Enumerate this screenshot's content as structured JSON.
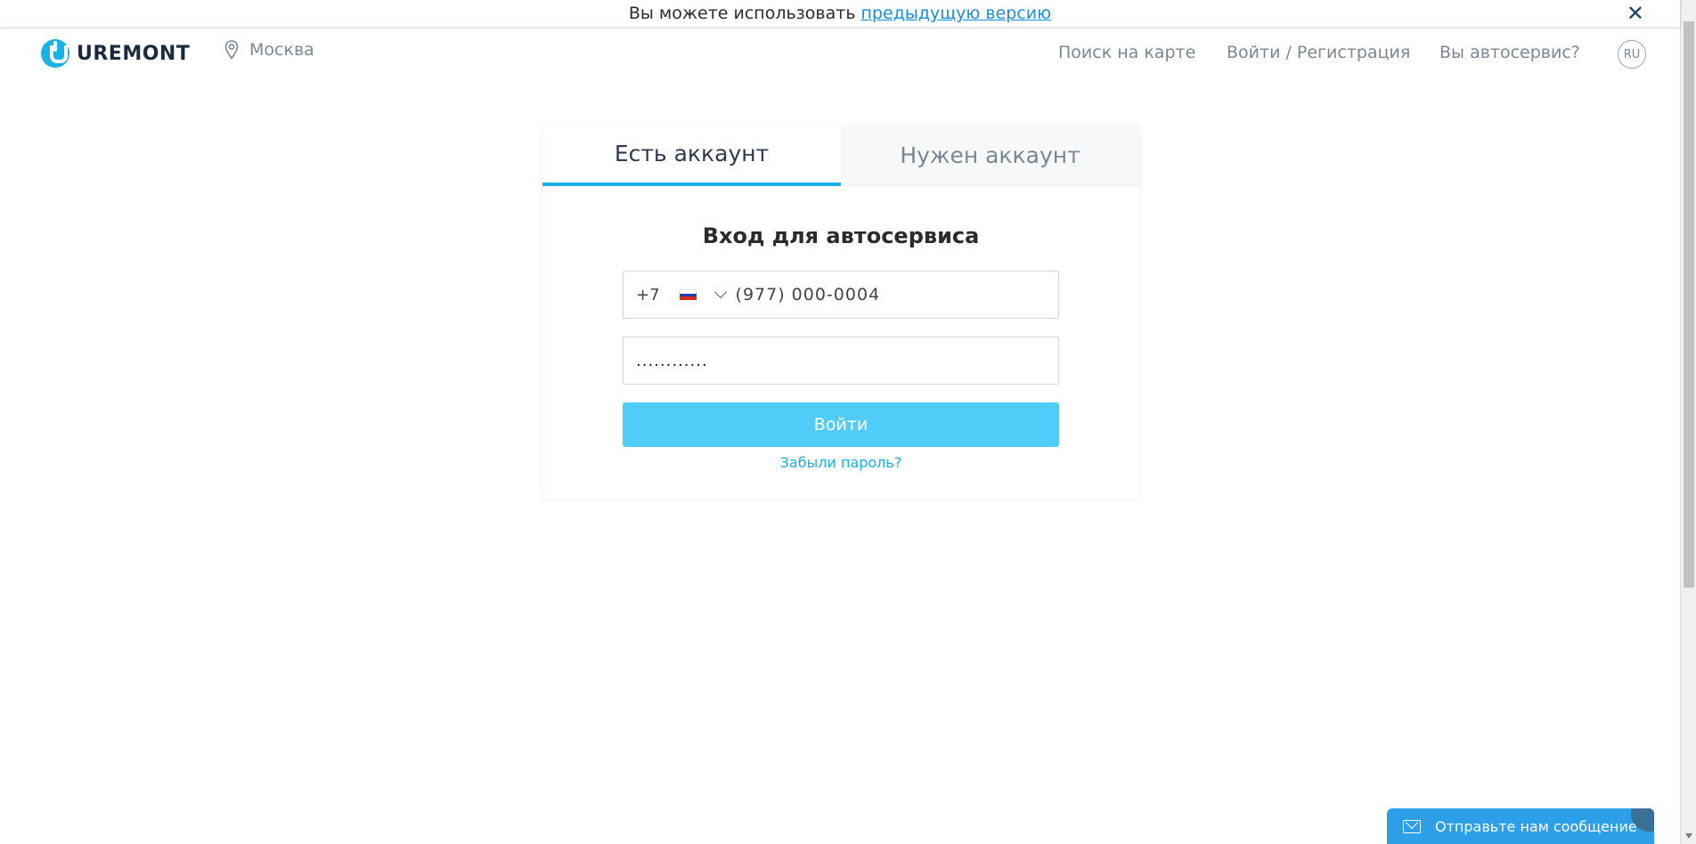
{
  "banner": {
    "text": "Вы можете использовать",
    "link": "предыдущую версию",
    "close_icon": "close-icon"
  },
  "header": {
    "logo_text": "UREMONT",
    "city": "Москва",
    "nav": {
      "map_search": "Поиск на карте",
      "login_register": "Войти / Регистрация",
      "autoservice": "Вы автосервис?"
    },
    "lang": "RU"
  },
  "card": {
    "tabs": [
      {
        "label": "Есть аккаунт",
        "active": true
      },
      {
        "label": "Нужен аккаунт",
        "active": false
      }
    ],
    "title": "Вход для автосервиса",
    "phone": {
      "country_code": "+7",
      "country": "RU",
      "value": "(977) 000-0004"
    },
    "password": {
      "masked_value": "............"
    },
    "submit_label": "Войти",
    "forgot_label": "Забыли пароль?"
  },
  "chat_widget": {
    "label": "Отправьте нам сообщение",
    "icon": "envelope-icon"
  },
  "colors": {
    "accent": "#1ab1e6",
    "button": "#4fcdf8",
    "link": "#1aaee6",
    "chat": "#2d9fe8"
  }
}
